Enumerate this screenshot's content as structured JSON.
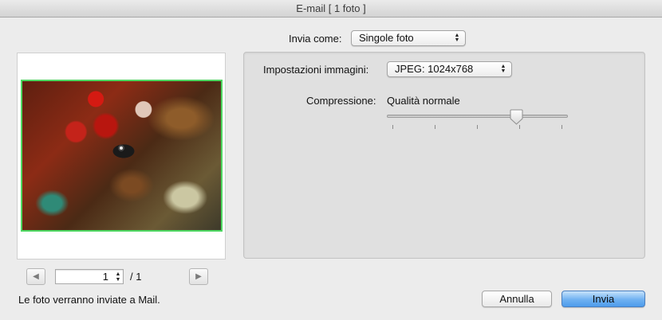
{
  "window": {
    "title": "E-mail [ 1 foto ]"
  },
  "send_as": {
    "label": "Invia come:",
    "selected": "Singole foto"
  },
  "image_settings": {
    "label": "Impostazioni immagini:",
    "selected": "JPEG: 1024x768"
  },
  "compression": {
    "label": "Compressione:",
    "value_text": "Qualità normale",
    "slider_position": 0.73,
    "tick_count": 5
  },
  "pager": {
    "current_page": "1",
    "total_label": "/ 1"
  },
  "footer": {
    "status": "Le foto verranno inviate a Mail.",
    "cancel_label": "Annulla",
    "send_label": "Invia"
  },
  "colors": {
    "photo_border": "#4ed862",
    "default_button": "#6fb1f1"
  },
  "icons": {
    "prev": "triangle-left-icon",
    "next": "triangle-right-icon",
    "popup": "updown-chevron-icon"
  }
}
